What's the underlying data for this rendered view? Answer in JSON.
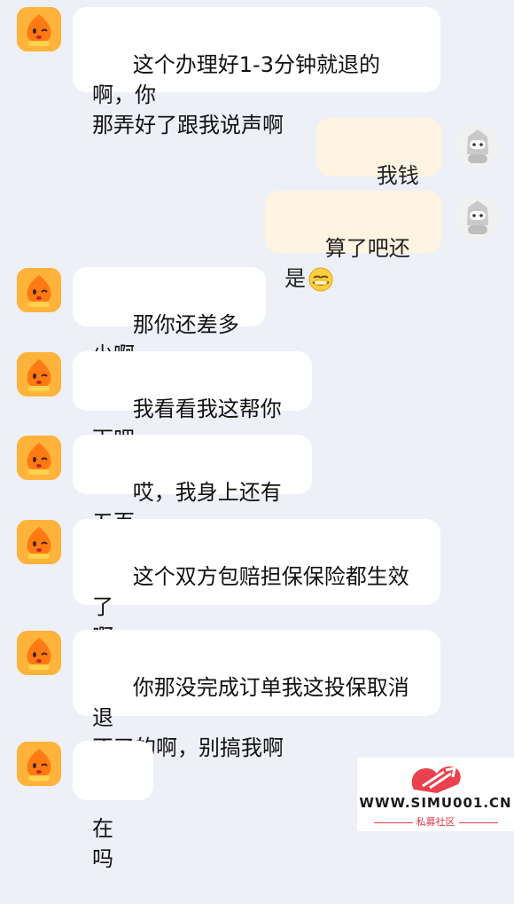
{
  "messages": [
    {
      "side": "left",
      "text": "这个办理好1-3分钟就退的啊，你\n那弄好了跟我说声啊"
    },
    {
      "side": "right",
      "text": "我钱不够"
    },
    {
      "side": "right",
      "text": "算了吧还是",
      "emoji": "facepalm-emoji"
    },
    {
      "side": "left",
      "text": "那你还差多少啊"
    },
    {
      "side": "left",
      "text": "我看看我这帮你下吧"
    },
    {
      "side": "left",
      "text": "哎，我身上还有五百"
    },
    {
      "side": "left",
      "text": "这个双方包赔担保保险都生效了\n啊"
    },
    {
      "side": "left",
      "text": "你那没完成订单我这投保取消退\n不了的啊，别搞我啊"
    },
    {
      "side": "left",
      "text": "在吗"
    }
  ],
  "watermark": {
    "url": "WWW.SIMU001.CN",
    "subtitle": "私募社区"
  },
  "colors": {
    "background": "#eef0f7",
    "left_bubble": "#ffffff",
    "right_bubble": "#fff4e1",
    "agent_avatar": "#ffb33a"
  }
}
